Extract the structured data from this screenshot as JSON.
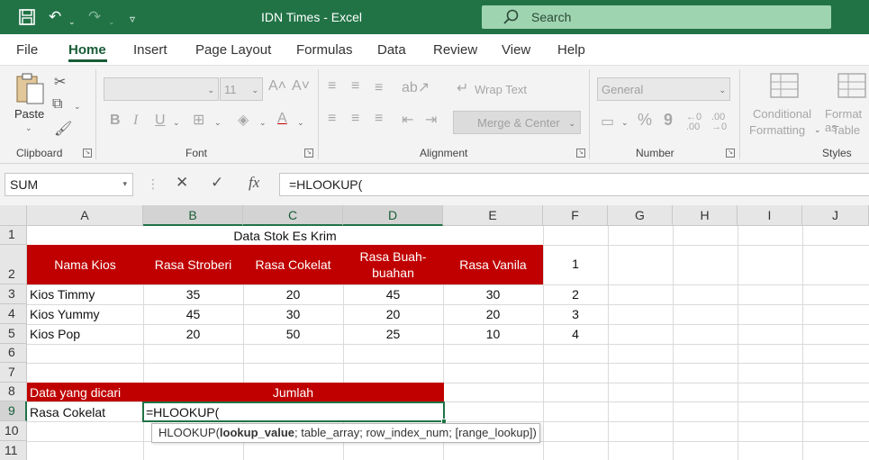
{
  "titlebar": {
    "title": "IDN Times  -  Excel",
    "search_label": "Search",
    "save_icon": "save-icon",
    "undo_icon": "undo-icon",
    "redo_icon": "redo-icon",
    "customize_icon": "customize-qat-icon"
  },
  "tabs": [
    "File",
    "Home",
    "Insert",
    "Page Layout",
    "Formulas",
    "Data",
    "Review",
    "View",
    "Help"
  ],
  "ribbon": {
    "clipboard": {
      "label": "Clipboard",
      "paste": "Paste"
    },
    "font": {
      "label": "Font",
      "size": "11",
      "bold": "B",
      "italic": "I",
      "underline": "U"
    },
    "alignment": {
      "label": "Alignment",
      "wrap": "Wrap Text",
      "merge": "Merge & Center"
    },
    "number": {
      "label": "Number",
      "format": "General",
      "percent": "%",
      "comma": "9",
      "inc_dec": "←0\n.00",
      "dec_dec": ".00\n→0"
    },
    "styles": {
      "label": "Styles",
      "conditional1": "Conditional",
      "conditional2": "Formatting",
      "format1": "Format as",
      "format2": "Table"
    }
  },
  "formula_bar": {
    "name_box": "SUM",
    "fx": "fx",
    "formula": "=HLOOKUP("
  },
  "columns": [
    "A",
    "B",
    "C",
    "D",
    "E",
    "F",
    "G",
    "H",
    "I",
    "J"
  ],
  "rows": [
    "1",
    "2",
    "3",
    "4",
    "5",
    "6",
    "7",
    "8",
    "9",
    "10",
    "11"
  ],
  "sheet": {
    "title": "Data Stok Es Krim",
    "headers": [
      "Nama Kios",
      "Rasa Stroberi",
      "Rasa Cokelat",
      "Rasa Buah-buahan",
      "Rasa Vanila"
    ],
    "header_d_line1": "Rasa Buah-",
    "header_d_line2": "buahan",
    "f2": "1",
    "data": [
      {
        "name": "Kios Timmy",
        "b": "35",
        "c": "20",
        "d": "45",
        "e": "30",
        "f": "2"
      },
      {
        "name": "Kios Yummy",
        "b": "45",
        "c": "30",
        "d": "20",
        "e": "20",
        "f": "3"
      },
      {
        "name": "Kios Pop",
        "b": "20",
        "c": "50",
        "d": "25",
        "e": "10",
        "f": "4"
      }
    ],
    "a8": "Data yang dicari",
    "b8": "Jumlah",
    "a9": "Rasa Cokelat",
    "b9": "=HLOOKUP(",
    "tooltip_fn": "HLOOKUP(",
    "tooltip_arg1": "lookup_value",
    "tooltip_rest": "; table_array; row_index_num; [range_lookup])"
  },
  "colors": {
    "excel_green": "#217346",
    "header_red": "#c00000"
  }
}
